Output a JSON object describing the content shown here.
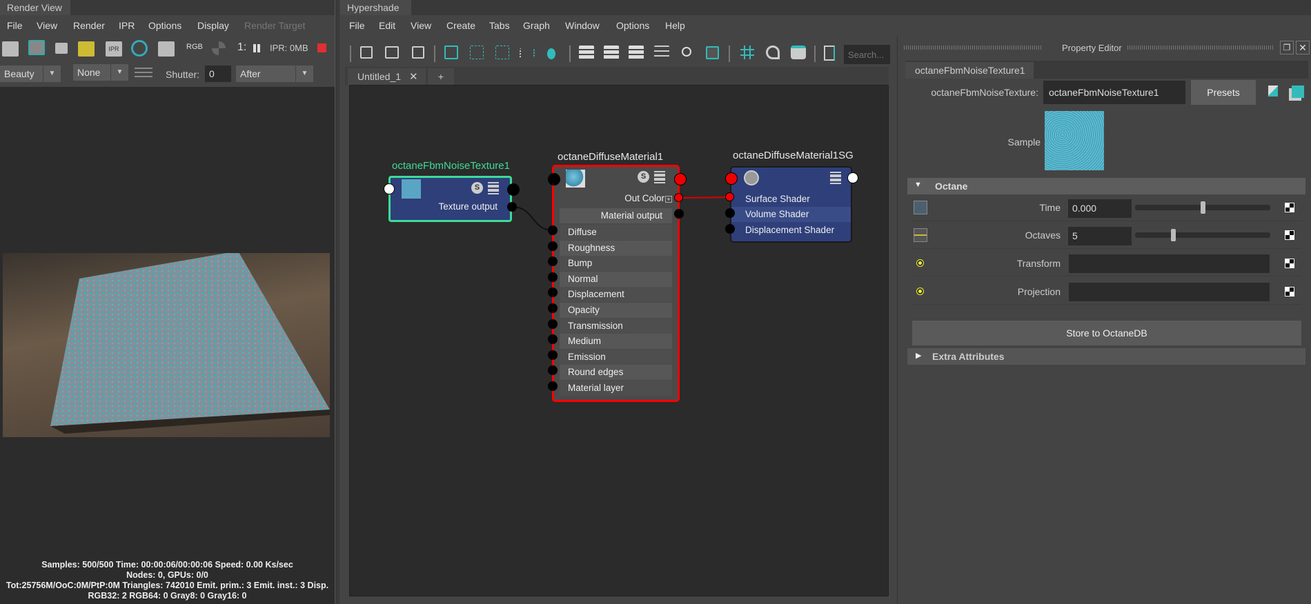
{
  "render_view": {
    "title": "Render View",
    "menu": [
      "File",
      "View",
      "Render",
      "IPR",
      "Options",
      "Display",
      "Render Target"
    ],
    "ipr_memory": "IPR: 0MB",
    "rgb_label": "RGB",
    "ipr_label": "IPR",
    "ratio_label": "1:",
    "pass_select": "Beauty",
    "compare_select": "None",
    "shutter_label": "Shutter:",
    "shutter_value": "0",
    "after_select": "After",
    "stats": [
      "Samples: 500/500 Time: 00:00:06/00:00:06 Speed: 0.00 Ks/sec",
      "Nodes: 0, GPUs: 0/0",
      "Tot:25756M/OoC:0M/PtP:0M Triangles: 742010 Emit. prim.: 3 Emit. inst.: 3 Disp.",
      "RGB32: 2 RGB64: 0 Gray8: 0 Gray16: 0"
    ]
  },
  "hypershade": {
    "title": "Hypershade",
    "menu": [
      "File",
      "Edit",
      "View",
      "Create",
      "Tabs",
      "Graph",
      "Window",
      "Options",
      "Help"
    ],
    "search_placeholder": "Search...",
    "tabs": [
      {
        "label": "Untitled_1"
      },
      {
        "label": "+"
      }
    ],
    "nodes": {
      "texture": {
        "title": "octaneFbmNoiseTexture1",
        "output": "Texture output",
        "color": "#3ddc97"
      },
      "material": {
        "title": "octaneDiffuseMaterial1",
        "out_color": "Out Color",
        "output": "Material output",
        "inputs": [
          "Diffuse",
          "Roughness",
          "Bump",
          "Normal",
          "Displacement",
          "Opacity",
          "Transmission",
          "Medium",
          "Emission",
          "Round edges",
          "Material layer"
        ],
        "color": "#ff0000"
      },
      "sg": {
        "title": "octaneDiffuseMaterial1SG",
        "inputs": [
          "Surface Shader",
          "Volume Shader",
          "Displacement Shader"
        ]
      }
    }
  },
  "property_editor": {
    "title": "Property Editor",
    "tab": "octaneFbmNoiseTexture1",
    "type_label": "octaneFbmNoiseTexture:",
    "name_value": "octaneFbmNoiseTexture1",
    "presets": "Presets",
    "sample_label": "Sample",
    "section": "Octane",
    "time": {
      "label": "Time",
      "value": "0.000",
      "slider": 0.5
    },
    "octaves": {
      "label": "Octaves",
      "value": "5",
      "slider": 0.28
    },
    "transform": {
      "label": "Transform",
      "value": ""
    },
    "projection": {
      "label": "Projection",
      "value": ""
    },
    "store_button": "Store to OctaneDB",
    "extra": "Extra Attributes"
  }
}
